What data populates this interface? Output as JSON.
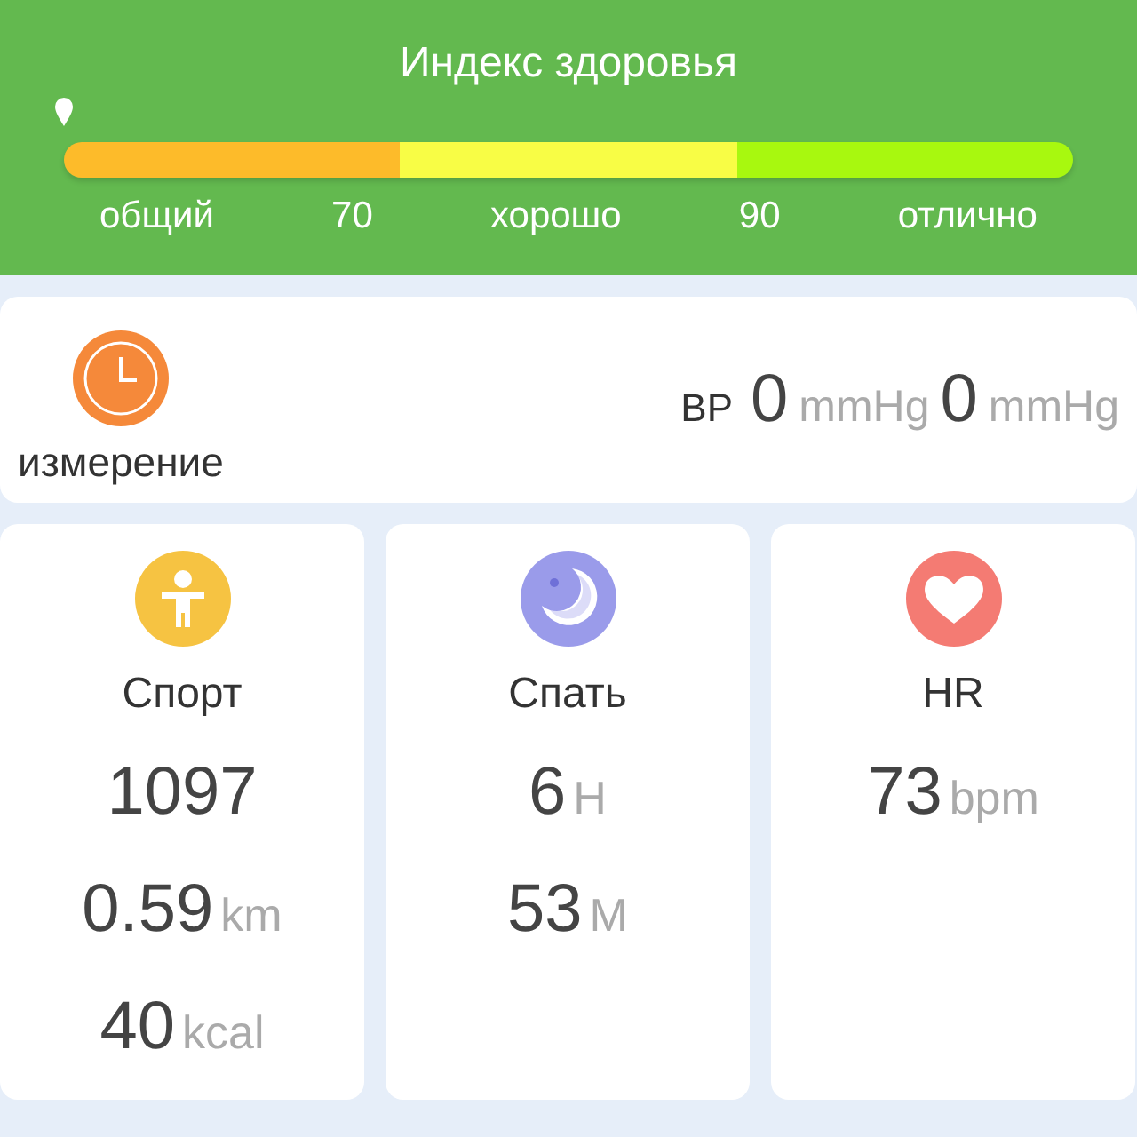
{
  "header": {
    "title": "Индекс здоровья",
    "segments": [
      {
        "color": "#fdbb2a"
      },
      {
        "color": "#f8fd45"
      },
      {
        "color": "#a8f80f"
      }
    ],
    "scale_labels": [
      "общий",
      "70",
      "хорошо",
      "90",
      "отлично"
    ]
  },
  "measure": {
    "label": "измерение",
    "bp_label": "BP",
    "readings": [
      {
        "value": "0",
        "unit": "mmHg"
      },
      {
        "value": "0",
        "unit": "mmHg"
      }
    ]
  },
  "cards": [
    {
      "kind": "sport",
      "title": "Спорт",
      "metrics": [
        {
          "value": "1097"
        },
        {
          "value": "0.59",
          "unit": "km"
        },
        {
          "value": "40",
          "unit": "kcal"
        }
      ]
    },
    {
      "kind": "sleep",
      "title": "Спать",
      "metrics": [
        {
          "value": "6",
          "unit": "H"
        },
        {
          "value": "53",
          "unit": "M"
        }
      ]
    },
    {
      "kind": "heart",
      "title": "HR",
      "metrics": [
        {
          "value": "73",
          "unit": "bpm"
        }
      ]
    }
  ]
}
